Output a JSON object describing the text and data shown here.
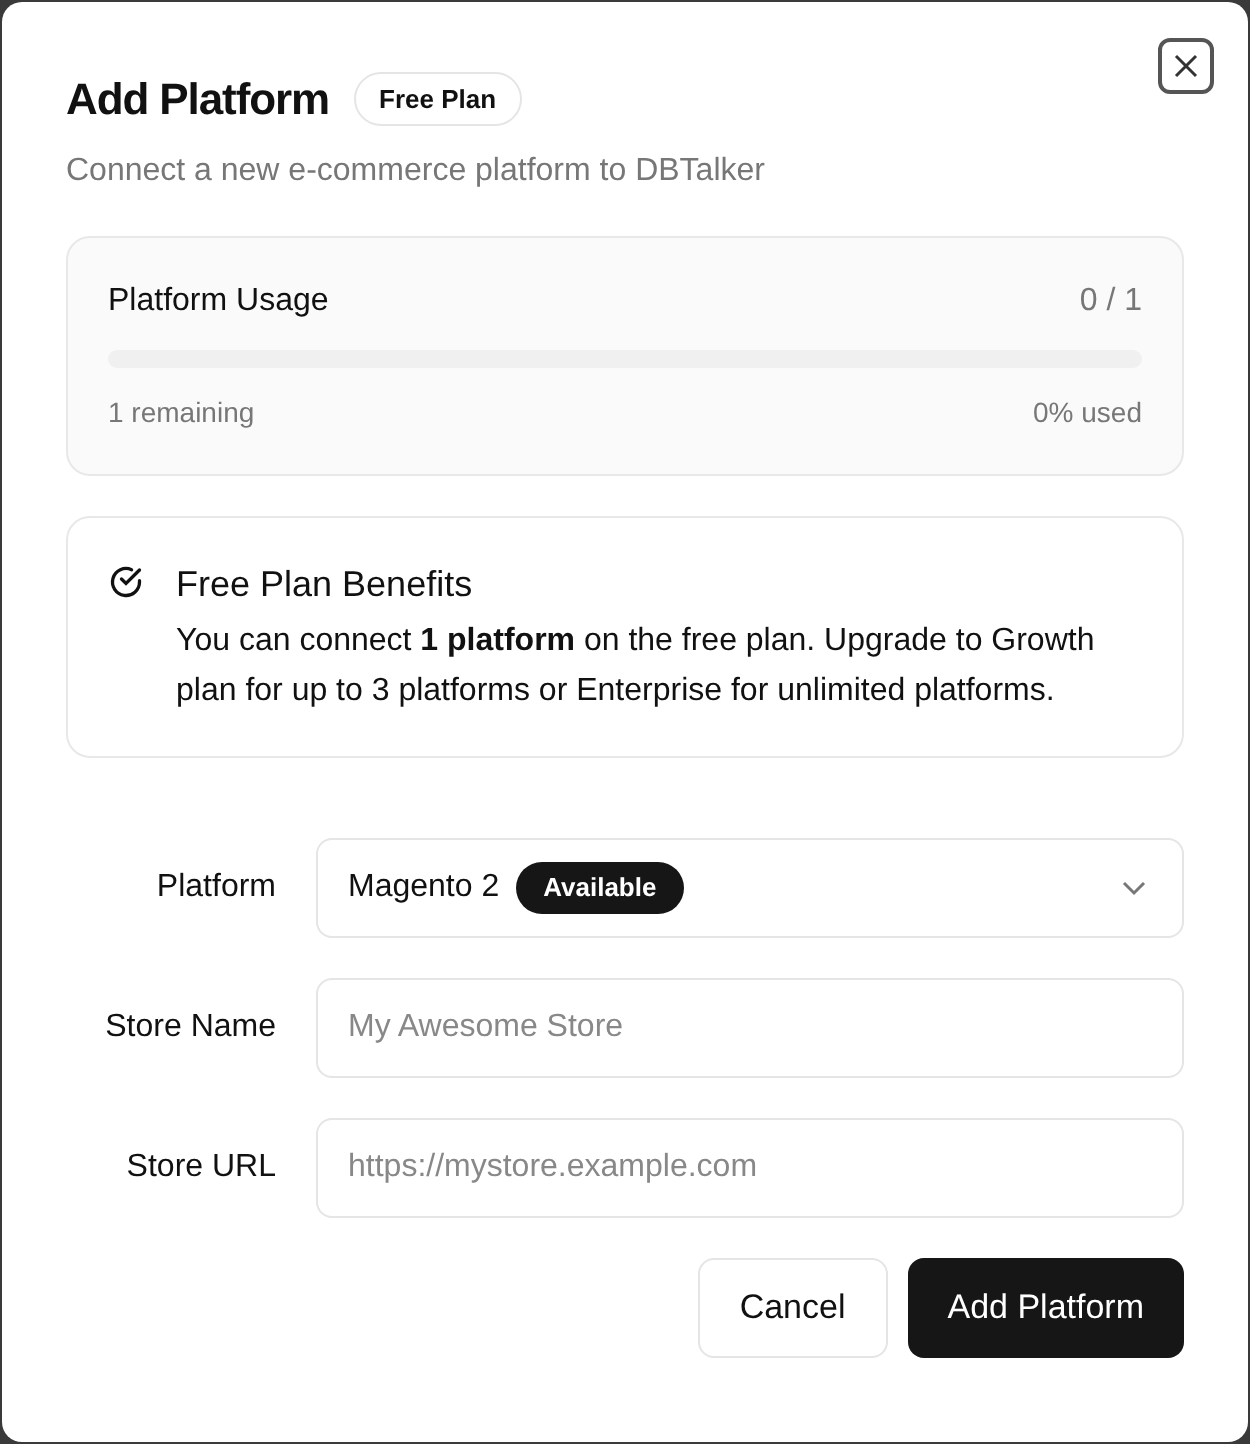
{
  "dialog": {
    "title": "Add Platform",
    "badge": "Free Plan",
    "subtitle": "Connect a new e-commerce platform to DBTalker"
  },
  "usage": {
    "title": "Platform Usage",
    "count": "0 / 1",
    "level": 0,
    "remaining": "1 remaining",
    "used": "0% used"
  },
  "benefits": {
    "title": "Free Plan Benefits",
    "text": "You can connect **1 platform** on the free plan. Upgrade to Growth plan for up to 3 platforms or Enterprise for unlimited platforms."
  },
  "fields": [
    {
      "kind": "select",
      "label": "Platform",
      "value": "Magento 2",
      "badge": "Available"
    },
    {
      "kind": "text",
      "label": "Store Name",
      "placeholder": "My Awesome Store"
    },
    {
      "kind": "text",
      "label": "Store URL",
      "placeholder": "https://mystore.example.com"
    }
  ],
  "buttons": [
    {
      "label": "Cancel",
      "kind": "secondary"
    },
    {
      "label": "Add Platform",
      "kind": "primary"
    }
  ]
}
